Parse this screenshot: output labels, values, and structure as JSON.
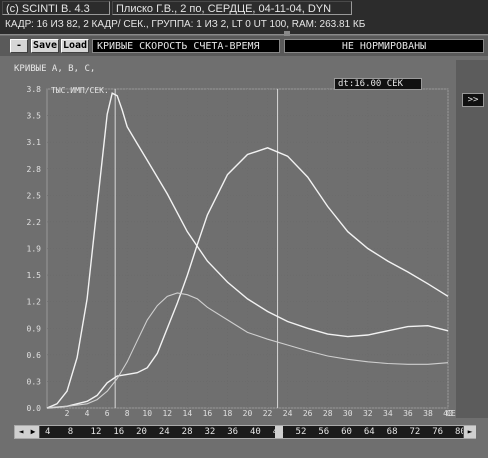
{
  "window": {
    "title_left": "(c) SCINTI B. 4.3",
    "title_right": "Плиско Г.В., 2 по, СЕРДЦЕ, 04-11-04, DYN"
  },
  "infobar": {
    "frame": "КАДР: 16 ИЗ 82",
    "frames_per": ", 2 КАДР/ СЕК.",
    "group": ", ГРУППА: 1 ИЗ 2",
    "lt": ", LT  0 UT 100",
    "ram": ", RAM: 263.81 КБ"
  },
  "toolbar": {
    "minus": "-",
    "save": "Save",
    "load": "Load",
    "curve_title": "КРИВЫЕ СКОРОСТЬ СЧЕТА-ВРЕМЯ",
    "norm": "НЕ НОРМИРОВАНЫ"
  },
  "panel": {
    "label": "КРИВЫЕ А, В, С,"
  },
  "dt_label": "dt:16.00 СЕК",
  "expand_label": ">>",
  "chart_data": {
    "type": "line",
    "ylabel": "ТЫС.ИМП/СЕК.",
    "xlabel": "СЕК.",
    "xlim": [
      0,
      40
    ],
    "ylim": [
      0,
      3.8
    ],
    "y_ticks": [
      "0.0",
      "0.3",
      "0.6",
      "0.9",
      "1.2",
      "1.5",
      "1.9",
      "2.2",
      "2.5",
      "2.8",
      "3.1",
      "3.5",
      "3.8"
    ],
    "x_ticks": [
      "2",
      "4",
      "6",
      "8",
      "10",
      "12",
      "14",
      "16",
      "18",
      "20",
      "22",
      "24",
      "26",
      "28",
      "30",
      "32",
      "34",
      "36",
      "38",
      "40"
    ],
    "markers_x": [
      6.8,
      23.0
    ],
    "series": [
      {
        "x": [
          0,
          1,
          2,
          3,
          4,
          5,
          6,
          6.5,
          7,
          7.5,
          8,
          9,
          10,
          12,
          14,
          16,
          18,
          20,
          22,
          24,
          26,
          28,
          30,
          32,
          34,
          36,
          38,
          40
        ],
        "y": [
          0,
          0.05,
          0.2,
          0.6,
          1.3,
          2.4,
          3.5,
          3.75,
          3.72,
          3.55,
          3.35,
          3.15,
          2.95,
          2.55,
          2.1,
          1.75,
          1.5,
          1.3,
          1.15,
          1.03,
          0.95,
          0.88,
          0.85,
          0.87,
          0.92,
          0.97,
          0.98,
          0.92
        ]
      },
      {
        "x": [
          0,
          2,
          4,
          5,
          6,
          7,
          8,
          9,
          10,
          11,
          12,
          13,
          14,
          15,
          16,
          18,
          20,
          22,
          24,
          26,
          28,
          30,
          32,
          34,
          36,
          38,
          40
        ],
        "y": [
          0,
          0.02,
          0.08,
          0.15,
          0.3,
          0.38,
          0.4,
          0.42,
          0.48,
          0.65,
          0.95,
          1.25,
          1.58,
          1.95,
          2.3,
          2.78,
          3.02,
          3.1,
          3.0,
          2.75,
          2.4,
          2.1,
          1.9,
          1.75,
          1.62,
          1.48,
          1.33
        ]
      },
      {
        "x": [
          0,
          2,
          4,
          5,
          6,
          7,
          8,
          9,
          10,
          11,
          12,
          13,
          14,
          15,
          16,
          18,
          20,
          22,
          24,
          26,
          28,
          30,
          32,
          34,
          36,
          38,
          40
        ],
        "y": [
          0,
          0.02,
          0.05,
          0.1,
          0.2,
          0.35,
          0.55,
          0.8,
          1.05,
          1.22,
          1.33,
          1.37,
          1.35,
          1.3,
          1.2,
          1.05,
          0.9,
          0.82,
          0.75,
          0.68,
          0.62,
          0.58,
          0.55,
          0.53,
          0.52,
          0.52,
          0.54
        ]
      }
    ]
  },
  "scrollbar": {
    "ticks": [
      "4",
      "8",
      "12",
      "16",
      "20",
      "24",
      "28",
      "32",
      "36",
      "40",
      "44",
      "52",
      "56",
      "60",
      "64",
      "68",
      "72",
      "76",
      "80"
    ]
  }
}
